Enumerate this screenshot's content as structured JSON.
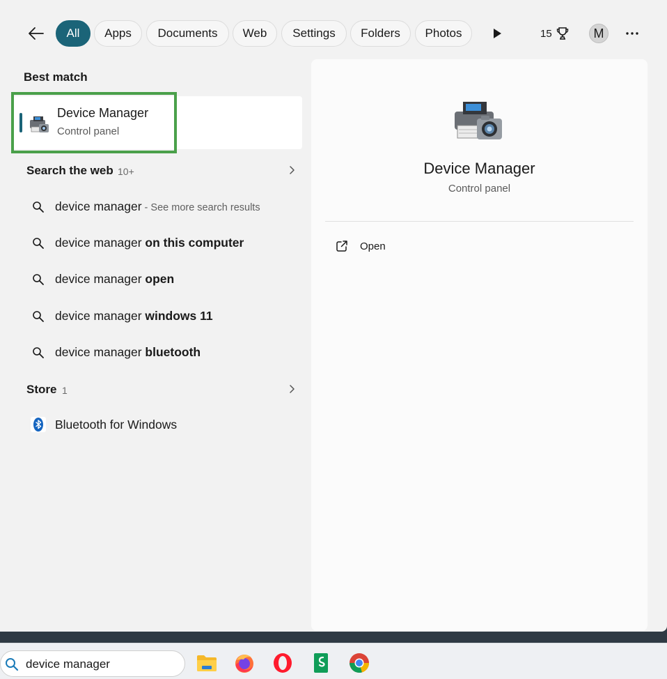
{
  "filters": {
    "tabs": [
      {
        "label": "All",
        "active": true
      },
      {
        "label": "Apps",
        "active": false
      },
      {
        "label": "Documents",
        "active": false
      },
      {
        "label": "Web",
        "active": false
      },
      {
        "label": "Settings",
        "active": false
      },
      {
        "label": "Folders",
        "active": false
      },
      {
        "label": "Photos",
        "active": false
      }
    ],
    "points": "15",
    "avatar_initial": "M"
  },
  "best_match": {
    "section_label": "Best match",
    "title": "Device Manager",
    "subtitle": "Control panel",
    "icon": "device-manager-icon"
  },
  "web_section": {
    "label": "Search the web",
    "count": "10+",
    "results": [
      {
        "plain": "device manager",
        "bold": "",
        "hint": " - See more search results"
      },
      {
        "plain": "device manager ",
        "bold": "on this computer",
        "hint": ""
      },
      {
        "plain": "device manager ",
        "bold": "open",
        "hint": ""
      },
      {
        "plain": "device manager ",
        "bold": "windows 11",
        "hint": ""
      },
      {
        "plain": "device manager ",
        "bold": "bluetooth",
        "hint": ""
      }
    ]
  },
  "store_section": {
    "label": "Store",
    "count": "1",
    "results": [
      {
        "label": "Bluetooth for Windows",
        "icon": "bluetooth-icon"
      }
    ]
  },
  "detail": {
    "title": "Device Manager",
    "subtitle": "Control panel",
    "actions": [
      {
        "label": "Open",
        "icon": "open-external-icon"
      }
    ]
  },
  "taskbar": {
    "search_value": "device manager",
    "apps": [
      "file-explorer-icon",
      "firefox-icon",
      "opera-icon",
      "sheets-app-icon",
      "chrome-icon"
    ]
  },
  "colors": {
    "accent": "#1b6478",
    "highlight_border": "#4aa04a"
  }
}
